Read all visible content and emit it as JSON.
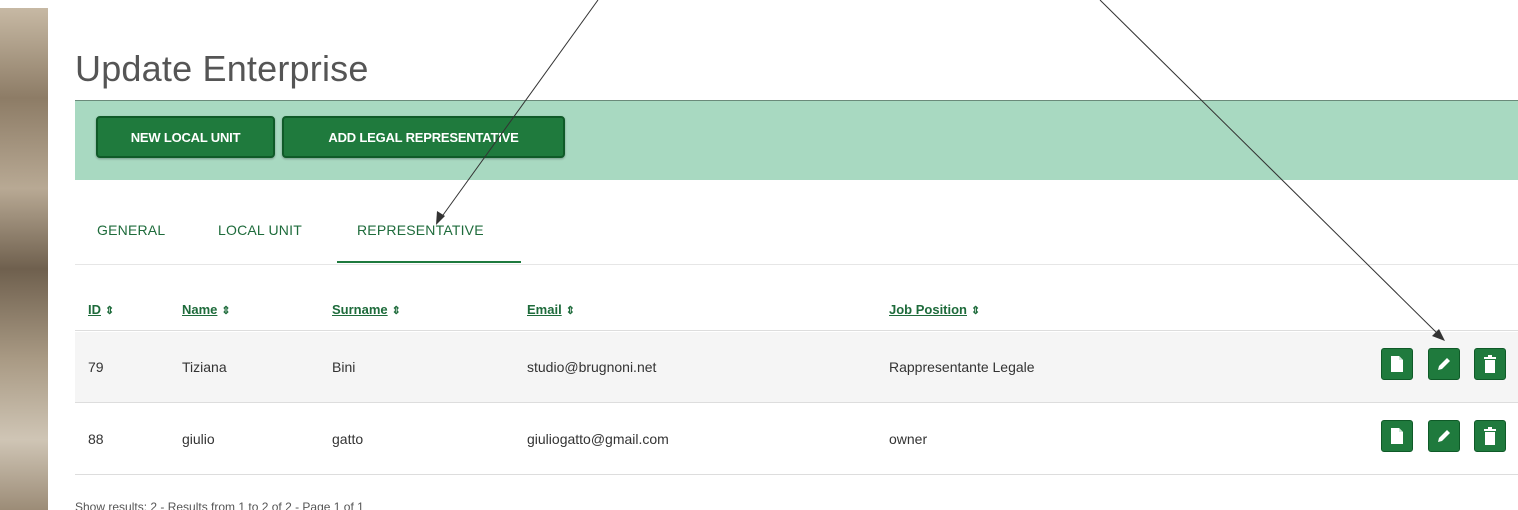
{
  "page": {
    "title": "Update Enterprise"
  },
  "toolbar": {
    "new_local_unit_label": "NEW LOCAL UNIT",
    "add_legal_rep_label": "ADD LEGAL REPRESENTATIVE"
  },
  "tabs": [
    {
      "label": "GENERAL",
      "active": false
    },
    {
      "label": "LOCAL UNIT",
      "active": false
    },
    {
      "label": "REPRESENTATIVE",
      "active": true
    }
  ],
  "table": {
    "columns": [
      {
        "label": "ID",
        "sortable": true
      },
      {
        "label": "Name",
        "sortable": true
      },
      {
        "label": "Surname",
        "sortable": true
      },
      {
        "label": "Email",
        "sortable": true
      },
      {
        "label": "Job Position",
        "sortable": true
      }
    ],
    "sort_icon": "sort-icon",
    "rows": [
      {
        "id": "79",
        "name": "Tiziana",
        "surname": "Bini",
        "email": "studio@brugnoni.net",
        "job_position": "Rappresentante Legale"
      },
      {
        "id": "88",
        "name": "giulio",
        "surname": "gatto",
        "email": "giuliogatto@gmail.com",
        "job_position": "owner"
      }
    ],
    "row_actions": [
      {
        "icon": "document-icon"
      },
      {
        "icon": "pencil-icon"
      },
      {
        "icon": "trash-icon"
      }
    ]
  },
  "footer": {
    "summary": "Show results: 2 - Results from 1 to 2 of 2 - Page 1 of 1"
  },
  "colors": {
    "primary_green": "#1f7a3d",
    "toolbar_bg": "#a8d9c1",
    "link_green": "#1e6b3b",
    "title_gray": "#555555"
  }
}
